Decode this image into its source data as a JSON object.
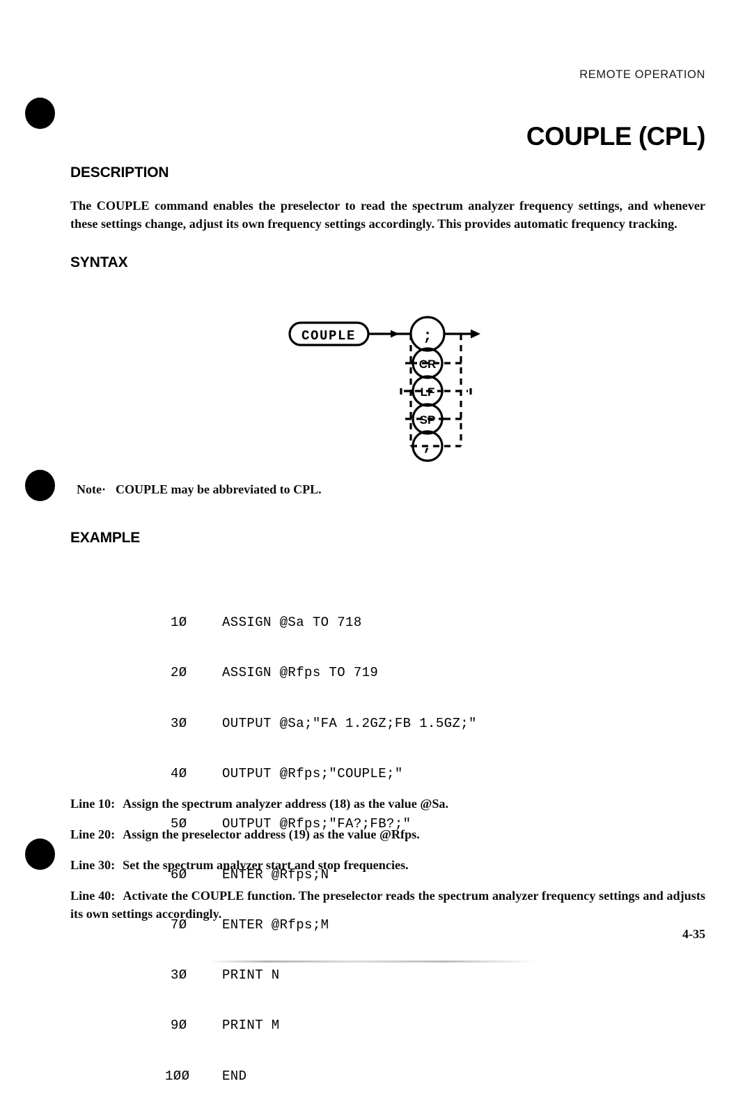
{
  "header": {
    "running_head": "REMOTE OPERATION",
    "command_title": "COUPLE (CPL)"
  },
  "sections": {
    "description_heading": "DESCRIPTION",
    "description_body": "The COUPLE command enables the preselector to read the spectrum analyzer frequency settings, and whenever these settings change, adjust its own frequency settings accordingly. This provides automatic frequency tracking.",
    "syntax_heading": "SYNTAX",
    "example_heading": "EXAMPLE"
  },
  "note": {
    "label": "Note·",
    "text": "COUPLE may be abbreviated to CPL."
  },
  "syntax_diagram": {
    "command_box": "COUPLE",
    "terminators": [
      {
        "label": ";",
        "style": "solid"
      },
      {
        "label": "CR",
        "style": "dashed"
      },
      {
        "label": "LF",
        "style": "dashed"
      },
      {
        "label": "SP",
        "style": "dashed"
      },
      {
        "label": ",",
        "style": "dashed"
      }
    ]
  },
  "code_listing": [
    {
      "line": "1Ø",
      "text": "ASSIGN @Sa TO 718"
    },
    {
      "line": "2Ø",
      "text": "ASSIGN @Rfps TO 719"
    },
    {
      "line": "3Ø",
      "text": "OUTPUT @Sa;\"FA 1.2GZ;FB 1.5GZ;\""
    },
    {
      "line": "4Ø",
      "text": "OUTPUT @Rfps;\"COUPLE;\""
    },
    {
      "line": "5Ø",
      "text": "OUTPUT @Rfps;\"FA?;FB?;\""
    },
    {
      "line": "6Ø",
      "text": "ENTER @Rfps;N"
    },
    {
      "line": "7Ø",
      "text": "ENTER @Rfps;M"
    },
    {
      "line": "3Ø",
      "text": "PRINT N"
    },
    {
      "line": "9Ø",
      "text": "PRINT M"
    },
    {
      "line": "1ØØ",
      "text": "END"
    }
  ],
  "explanations": [
    {
      "label": "Line 10:",
      "text": "Assign the spectrum analyzer address (18) as the value @Sa."
    },
    {
      "label": "Line 20:",
      "text": "Assign the preselector address (19) as the value @Rfps."
    },
    {
      "label": "Line 30:",
      "text": "Set the spectrum analyzer start and stop frequencies."
    },
    {
      "label": "Line 40:",
      "text": "Activate the COUPLE function. The preselector reads the spectrum analyzer frequency settings and adjusts its own settings accordingly."
    }
  ],
  "footer": {
    "page_number": "4-35"
  },
  "colors": {
    "ink": "#000000",
    "paper": "#ffffff"
  }
}
